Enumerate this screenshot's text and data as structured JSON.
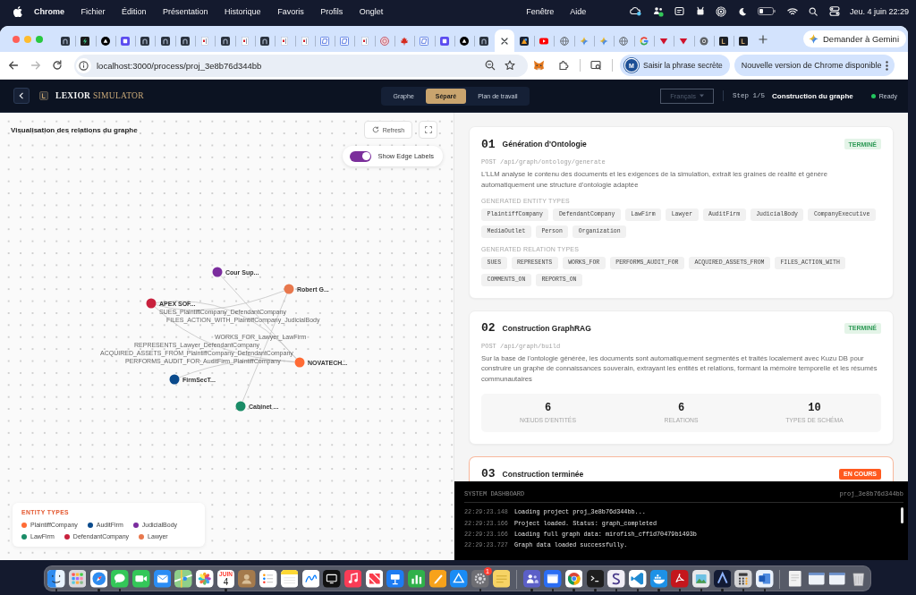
{
  "menu_bar": {
    "app_name": "Chrome",
    "menus": [
      "Fichier",
      "Édition",
      "Présentation",
      "Historique",
      "Favoris",
      "Profils",
      "Onglet"
    ],
    "menus_right": [
      "Fenêtre",
      "Aide"
    ],
    "clock": "Jeu. 4 juin 22:29"
  },
  "browser": {
    "tabs": [
      {
        "kind": "arch",
        "selected": false
      },
      {
        "kind": "bolt",
        "selected": false
      },
      {
        "kind": "triangle",
        "selected": false
      },
      {
        "kind": "square",
        "selected": false
      },
      {
        "kind": "arch",
        "selected": false
      },
      {
        "kind": "arch",
        "selected": false
      },
      {
        "kind": "arch",
        "selected": false
      },
      {
        "kind": "page",
        "selected": false
      },
      {
        "kind": "arch",
        "selected": false
      },
      {
        "kind": "page",
        "selected": false
      },
      {
        "kind": "arch",
        "selected": false
      },
      {
        "kind": "page",
        "selected": false
      },
      {
        "kind": "page",
        "selected": false
      },
      {
        "kind": "frame",
        "selected": false
      },
      {
        "kind": "frame",
        "selected": false
      },
      {
        "kind": "page",
        "selected": false
      },
      {
        "kind": "seal",
        "selected": false
      },
      {
        "kind": "maple",
        "selected": false
      },
      {
        "kind": "frame",
        "selected": false
      },
      {
        "kind": "square",
        "selected": false
      },
      {
        "kind": "triangle",
        "selected": false
      },
      {
        "kind": "arch",
        "selected": false
      },
      {
        "selected": true
      },
      {
        "kind": "colorful",
        "selected": false
      },
      {
        "kind": "video",
        "selected": false
      },
      {
        "kind": "globe",
        "selected": false
      },
      {
        "kind": "sparkle",
        "selected": false
      },
      {
        "kind": "sparkle",
        "selected": false
      },
      {
        "kind": "globe",
        "selected": false
      },
      {
        "kind": "google",
        "selected": false
      },
      {
        "kind": "down",
        "selected": false
      },
      {
        "kind": "down",
        "selected": false
      },
      {
        "kind": "chrome",
        "selected": false
      },
      {
        "kind": "bracket",
        "selected": false
      },
      {
        "kind": "bracket",
        "selected": false
      }
    ],
    "gemini_button": "Demander à Gemini",
    "back_disabled": false,
    "forward_disabled": true,
    "url": "localhost:3000/process/proj_3e8b76d344bb",
    "profile_chip": {
      "avatar": "M",
      "label": "Saisir la phrase secrète"
    },
    "update_chip": "Nouvelle version de Chrome disponible"
  },
  "app_header": {
    "brand": {
      "name": "LEXIOR",
      "suffix": "SIMULATOR"
    },
    "view_modes": [
      {
        "label": "Graphe",
        "selected": false
      },
      {
        "label": "Séparé",
        "selected": true
      },
      {
        "label": "Plan de travail",
        "selected": false
      }
    ],
    "language": {
      "value": "Français",
      "disabled": true
    },
    "step": {
      "counter": "Step 1/5",
      "title": "Construction du graphe"
    },
    "status": "Ready"
  },
  "graph_panel": {
    "title": "Visualisation des relations du graphe",
    "refresh_button": "Refresh",
    "edge_labels_toggle": {
      "label": "Show Edge Labels",
      "on": true
    },
    "nodes": [
      {
        "label": "Cour Sup...",
        "color": "#7b2d9e"
      },
      {
        "label": "Robert G...",
        "color": "#e8784d"
      },
      {
        "label": "APEX SOF...",
        "color": "#c8213d"
      },
      {
        "label": "NOVATECH...",
        "color": "#ff6b35"
      },
      {
        "label": "FirmSecT...",
        "color": "#0a4a8c"
      },
      {
        "label": "Cabinet ...",
        "color": "#1a8c67"
      }
    ],
    "edges": [
      {
        "label": "SUES_PlaintiffCompany_DefendantCompany"
      },
      {
        "label": "FILES_ACTION_WITH_PlaintiffCompany_JudicialBody"
      },
      {
        "label": "WORKS_FOR_Lawyer_LawFirm"
      },
      {
        "label": "REPRESENTS_Lawyer_DefendantCompany"
      },
      {
        "label": "ACQUIRED_ASSETS_FROM_PlaintiffCompany_DefendantCompany"
      },
      {
        "label": "PERFORMS_AUDIT_FOR_AuditFirm_PlaintiffCompany"
      }
    ],
    "legend": {
      "title": "ENTITY TYPES",
      "items": [
        {
          "label": "PlaintiffCompany",
          "color": "#ff6b35"
        },
        {
          "label": "AuditFirm",
          "color": "#0a4a8c"
        },
        {
          "label": "JudicialBody",
          "color": "#7b2d9e"
        },
        {
          "label": "LawFirm",
          "color": "#1a8c67"
        },
        {
          "label": "DefendantCompany",
          "color": "#c8213d"
        },
        {
          "label": "Lawyer",
          "color": "#e8784d"
        }
      ]
    }
  },
  "steps": [
    {
      "number": "01",
      "title": "Génération d'Ontologie",
      "status": {
        "kind": "done",
        "label": "TERMINÉ"
      },
      "endpoint": "POST /api/graph/ontology/generate",
      "description": "L'LLM analyse le contenu des documents et les exigences de la simulation, extrait les graines de réalité et génère automatiquement une structure d'ontologie adaptée",
      "tag_groups": [
        {
          "title": "GENERATED ENTITY TYPES",
          "tags": [
            "PlaintiffCompany",
            "DefendantCompany",
            "LawFirm",
            "Lawyer",
            "AuditFirm",
            "JudicialBody",
            "CompanyExecutive",
            "MediaOutlet",
            "Person",
            "Organization"
          ]
        },
        {
          "title": "GENERATED RELATION TYPES",
          "tags": [
            "SUES",
            "REPRESENTS",
            "WORKS_FOR",
            "PERFORMS_AUDIT_FOR",
            "ACQUIRED_ASSETS_FROM",
            "FILES_ACTION_WITH",
            "COMMENTS_ON",
            "REPORTS_ON"
          ]
        }
      ]
    },
    {
      "number": "02",
      "title": "Construction GraphRAG",
      "status": {
        "kind": "done",
        "label": "TERMINÉ"
      },
      "endpoint": "POST /api/graph/build",
      "description": "Sur la base de l'ontologie générée, les documents sont automatiquement segmentés et traités localement avec Kuzu DB pour construire un graphe de connaissances souverain, extrayant les entités et relations, formant la mémoire temporelle et les résumés communautaires",
      "stats": [
        {
          "value": "6",
          "label": "NŒUDS D'ENTITÉS"
        },
        {
          "value": "6",
          "label": "RELATIONS"
        },
        {
          "value": "10",
          "label": "TYPES DE SCHÉMA"
        }
      ]
    },
    {
      "number": "03",
      "title": "Construction terminée",
      "status": {
        "kind": "active",
        "label": "EN COURS"
      }
    }
  ],
  "dashboard": {
    "title": "SYSTEM DASHBOARD",
    "project": "proj_3e8b76d344bb",
    "logs": [
      {
        "time": "22:29:23.148",
        "message": "Loading project proj_3e8b76d344bb..."
      },
      {
        "time": "22:29:23.166",
        "message": "Project loaded. Status: graph_completed"
      },
      {
        "time": "22:29:23.166",
        "message": "Loading full graph data: mirofish_cff1d70479b1493b"
      },
      {
        "time": "22:29:23.727",
        "message": "Graph data loaded successfully."
      }
    ]
  },
  "dock": {
    "apps": [
      {
        "kind": "face",
        "running": true
      },
      {
        "kind": "grid",
        "running": false
      },
      {
        "kind": "compass",
        "running": true
      },
      {
        "kind": "chat",
        "running": true
      },
      {
        "kind": "video",
        "running": false
      },
      {
        "kind": "mail",
        "running": false
      },
      {
        "kind": "map",
        "running": false
      },
      {
        "kind": "flower",
        "running": false
      },
      {
        "kind": "calendar",
        "month": "JUIN",
        "day": "4",
        "running": true
      },
      {
        "kind": "contact",
        "running": false
      },
      {
        "kind": "list",
        "running": false
      },
      {
        "kind": "note",
        "running": false
      },
      {
        "kind": "scribble",
        "running": false
      },
      {
        "kind": "screen",
        "running": false
      },
      {
        "kind": "music",
        "running": false
      },
      {
        "kind": "news",
        "running": false
      },
      {
        "kind": "podium",
        "running": false
      },
      {
        "kind": "bars",
        "running": false
      },
      {
        "kind": "pen",
        "running": false
      },
      {
        "kind": "store",
        "running": false
      },
      {
        "kind": "gear",
        "badge": "1",
        "running": true
      },
      {
        "kind": "sticky",
        "running": false
      }
    ],
    "recent_apps": [
      {
        "kind": "people",
        "running": true
      },
      {
        "kind": "window",
        "running": true
      },
      {
        "kind": "chrome",
        "running": true
      },
      {
        "kind": "terminal",
        "running": true
      },
      {
        "kind": "curve",
        "running": true
      },
      {
        "kind": "code",
        "running": true
      },
      {
        "kind": "whale",
        "running": true
      },
      {
        "kind": "pdf",
        "running": true
      },
      {
        "kind": "photo",
        "running": true
      },
      {
        "kind": "peak",
        "running": true
      },
      {
        "kind": "calc",
        "running": true
      },
      {
        "kind": "doc",
        "running": true
      }
    ],
    "stacks": [
      {
        "kind": "page",
        "running": false
      },
      {
        "kind": "screenshot",
        "running": false
      },
      {
        "kind": "screenshot",
        "running": false
      },
      {
        "kind": "trash",
        "running": false
      }
    ]
  }
}
